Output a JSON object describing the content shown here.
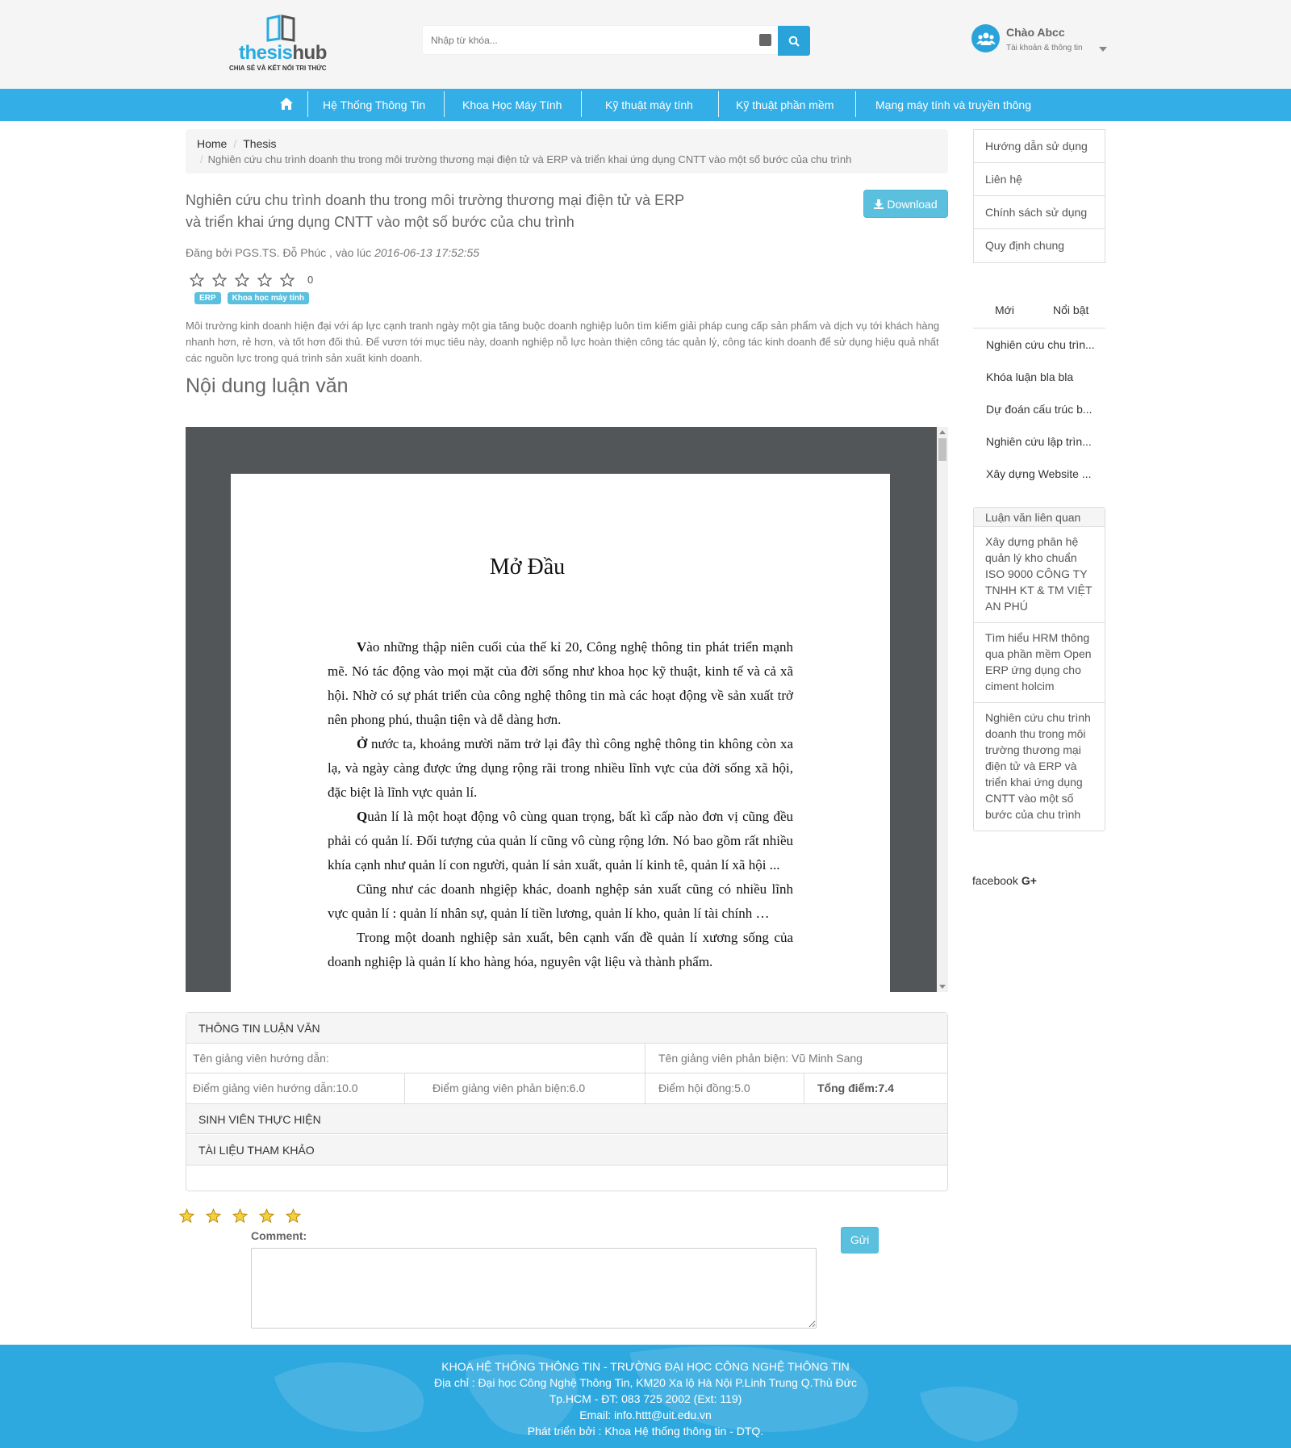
{
  "header": {
    "logo_text_a": "thesis",
    "logo_text_b": "hub",
    "logo_tagline": "CHIA SẺ VÀ KẾT NỐI TRI THỨC",
    "search_placeholder": "Nhập từ khóa...",
    "user_greeting": "Chào Abcc",
    "user_account_label": "Tài khoản & thông tin"
  },
  "nav": {
    "items": [
      {
        "label": "Hệ Thống Thông Tin"
      },
      {
        "label": "Khoa Học Máy Tính"
      },
      {
        "label": "Kỹ thuật máy tính"
      },
      {
        "label": "Kỹ thuật phần mềm"
      },
      {
        "label": "Mạng máy tính và truyền thông"
      }
    ]
  },
  "breadcrumb": {
    "home": "Home",
    "thesis": "Thesis",
    "current": "Nghiên cứu chu trình doanh thu trong môi trường thương mại điện tử và ERP và triển khai ứng dụng CNTT vào một số bước của chu trình"
  },
  "thesis": {
    "title_line1": "Nghiên cứu chu trình doanh thu trong môi trường thương mại điện tử và ERP",
    "title_line2": "và triển khai ứng dụng CNTT vào một số bước của chu trình",
    "download_label": "Download",
    "posted_prefix": "Đăng bởi PGS.TS. Đỗ Phúc , vào lúc ",
    "posted_time": "2016-06-13 17:52:55",
    "rating_count": "0",
    "rating_value": 0,
    "tags": [
      "ERP",
      "Khoa học máy tính"
    ],
    "description": "Môi trường kinh doanh hiện đại với áp lực cạnh tranh ngày một gia tăng buộc doanh nghiệp luôn tìm kiếm giải pháp cung cấp sản phẩm và dịch vụ tới khách hàng nhanh hơn, rẻ hơn, và tốt hơn đối thủ. Để vươn tới mục tiêu này, doanh nghiệp nỗ lực hoàn thiện công tác quản lý, công tác kinh doanh để sử dụng hiệu quả nhất các nguồn lực trong quá trình sản xuất kinh doanh.",
    "content_heading": "Nội dung luận văn"
  },
  "document": {
    "heading": "Mở Đầu",
    "paragraphs": [
      {
        "lead": "V",
        "text": "ào những thập niên cuối của thế kỉ 20, Công nghệ thông tin phát triển mạnh mẽ. Nó tác động vào mọi mặt của đời sống như khoa học kỹ thuật, kinh tế và cả xã hội. Nhờ có sự phát triển của công nghệ thông tin mà các  hoạt động về sản xuất trở nên phong phú, thuận tiện và dễ dàng hơn."
      },
      {
        "lead": "Ở",
        "text": " nước ta, khoảng mười năm trở lại đây thì công nghệ thông tin không còn xa lạ, và ngày càng được  ứng dụng rộng rãi trong nhiều lĩnh vực của đời sống xã hội, đặc biệt là lĩnh vực quản lí."
      },
      {
        "lead": "Q",
        "text": "uản lí là một hoạt động vô cùng quan trọng, bất kì cấp nào đơn vị  cũng đều phải có quản lí. Đối tượng của quản lí cũng vô cùng rộng lớn. Nó bao gồm rất nhiều khía cạnh như quản lí con người, quản lí sản xuất, quản lí kinh tê, quản lí xã hội ..."
      },
      {
        "lead": "",
        "text": "Cũng như các doanh nhgiệp khác, doanh nghệp sản xuất cũng có nhiều lĩnh vực quản lí : quản lí nhân sự, quản lí tiền lương, quản lí kho, quản lí tài chính …"
      },
      {
        "lead": "",
        "text": "Trong một doanh nghiệp sản xuất, bên cạnh vấn đề quản lí xương sống của doanh nghiệp là quản lí kho hàng hóa, nguyên vật liệu và thành phẩm."
      }
    ]
  },
  "info": {
    "header": "THÔNG TIN LUẬN VĂN",
    "advisor_label": "Tên giảng viên hướng dẫn:",
    "reviewer_label": "Tên giảng viên phản biện: Vũ Minh Sang",
    "advisor_score": "Điểm giảng viên hướng dẫn:10.0",
    "reviewer_score": "Điểm giảng viên phản biện:6.0",
    "council_score": "Điểm hội đồng:5.0",
    "total_score": "Tổng điểm:7.4",
    "students_header": "SINH VIÊN THỰC HIỆN",
    "references_header": "TÀI LIỆU THAM KHẢO"
  },
  "comment": {
    "label": "Comment:",
    "value": "",
    "send_label": "Gửi",
    "stars": 5
  },
  "sidebar": {
    "menu": [
      "Hướng dẫn sử dụng",
      "Liên hệ",
      "Chính sách sử dụng",
      "Quy định chung"
    ],
    "tab_new": "Mới",
    "tab_featured": "Nổi bật",
    "recent": [
      "Nghiên cứu chu trìn...",
      "Khóa luận bla bla",
      "Dự đoán cấu trúc b...",
      "Nghiên cứu lập trìn...",
      "Xây dựng Website ..."
    ],
    "related_header": "Luận văn liên quan",
    "related": [
      "Xây dựng phân hệ quản lý kho chuẩn ISO 9000 CÔNG TY TNHH KT & TM VIỆT AN PHÚ",
      "Tìm hiểu HRM thông qua phần mềm Open ERP ứng dụng cho ciment holcim",
      "Nghiên cứu chu trình doanh thu trong môi trường thương mại điện tử và ERP và triển khai ứng dụng CNTT vào một số bước của chu trình"
    ],
    "facebook": "facebook",
    "gplus": "G+"
  },
  "footer": {
    "line1": "KHOA HỆ THỐNG THÔNG TIN - TRƯỜNG ĐẠI HỌC CÔNG NGHỆ THÔNG TIN",
    "line2": "Địa chỉ : Đại học Công Nghệ Thông Tin, KM20 Xa lộ Hà Nội P.Linh Trung Q.Thủ Đức",
    "line3": "Tp.HCM - ĐT: 083 725 2002 (Ext: 119)",
    "line4": "Email: info.httt@uit.edu.vn",
    "line5": "Phát triển bởi : Khoa Hệ thống thông tin - DTQ."
  },
  "colors": {
    "brand": "#33aee6",
    "button": "#5bc0de",
    "star": "#f0c419"
  }
}
